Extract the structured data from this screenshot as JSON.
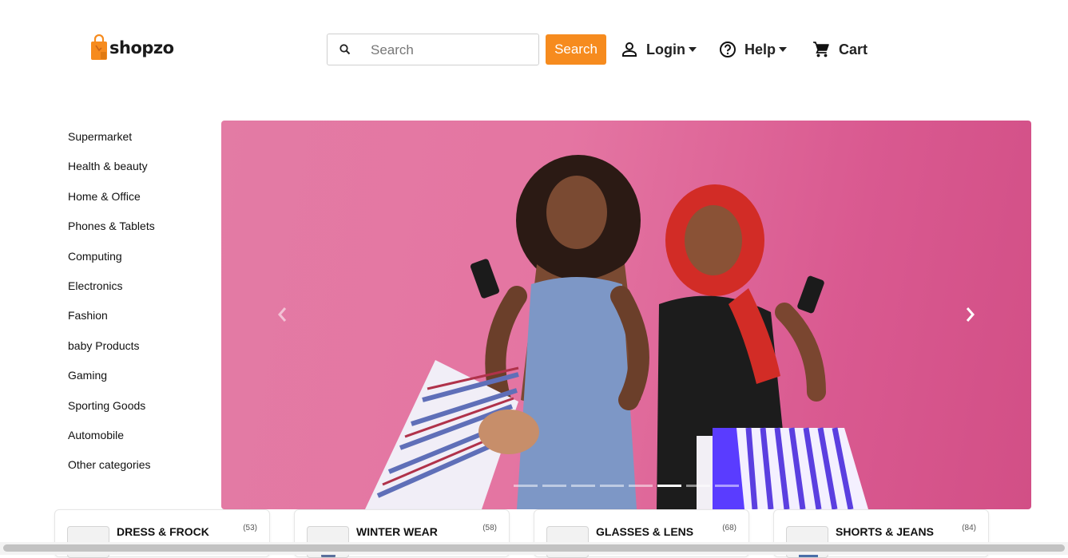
{
  "header": {
    "logo_text": "shopzo",
    "search": {
      "placeholder": "Search",
      "value": "",
      "button_label": "Search"
    },
    "nav": {
      "login_label": "Login",
      "help_label": "Help",
      "cart_label": "Cart"
    }
  },
  "sidebar": {
    "items": [
      {
        "label": "Supermarket"
      },
      {
        "label": "Health & beauty"
      },
      {
        "label": "Home & Office"
      },
      {
        "label": "Phones & Tablets"
      },
      {
        "label": "Computing"
      },
      {
        "label": "Electronics"
      },
      {
        "label": "Fashion"
      },
      {
        "label": "baby Products"
      },
      {
        "label": "Gaming"
      },
      {
        "label": "Sporting Goods"
      },
      {
        "label": "Automobile"
      },
      {
        "label": "Other categories"
      }
    ]
  },
  "carousel": {
    "slide_count": 8,
    "active_index": 5,
    "prev_icon": "chevron-left-icon",
    "next_icon": "chevron-right-icon"
  },
  "categories": [
    {
      "title": "DRESS & FROCK",
      "count": "(53)"
    },
    {
      "title": "WINTER WEAR",
      "count": "(58)"
    },
    {
      "title": "GLASSES & LENS",
      "count": "(68)"
    },
    {
      "title": "SHORTS & JEANS",
      "count": "(84)"
    }
  ],
  "colors": {
    "accent": "#f68b1e",
    "hero_background": "#e27aa3",
    "text": "#1a1a1a"
  }
}
